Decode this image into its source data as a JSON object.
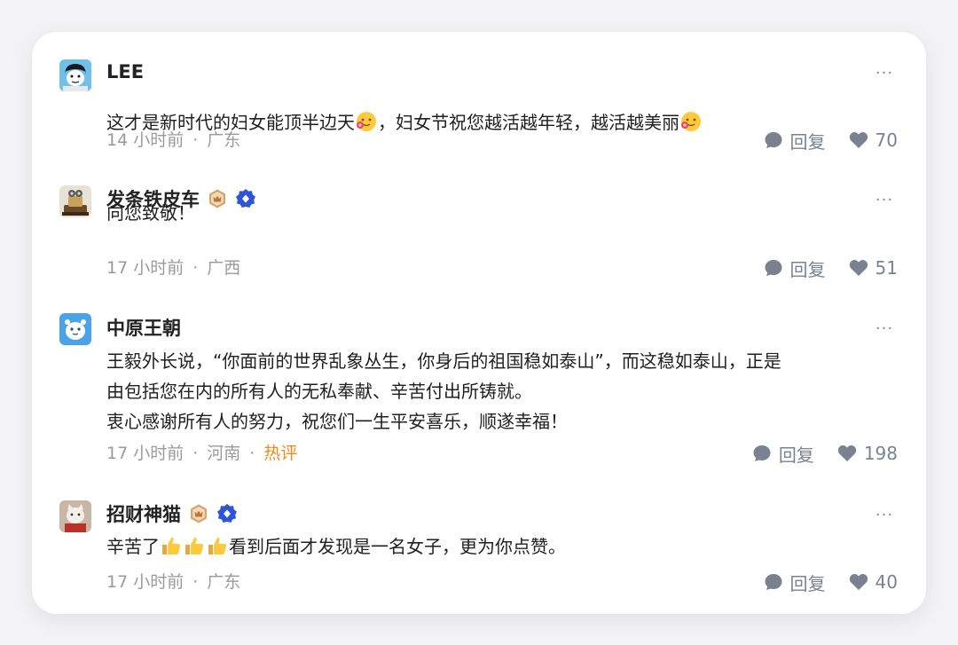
{
  "comments": [
    {
      "user": "LEE",
      "avatar_icon": "cartoon-face-avatar",
      "badges": [],
      "lines": [
        {
          "pre": "这才是新时代的妇女能顶半边天",
          "emoji": "flower-smile-emoji",
          "mid": "，妇女节祝您越活越年轻，越活越美丽",
          "emoji2": "flower-smile-emoji"
        }
      ],
      "time": "14 小时前",
      "location": "广东",
      "hot": "",
      "reply_label": "回复",
      "likes": "70"
    },
    {
      "user": "发条铁皮车",
      "avatar_icon": "robot-avatar",
      "badges": [
        "crown-badge-icon",
        "verified-badge-icon"
      ],
      "lines": [
        {
          "text": "向您致敬！"
        }
      ],
      "time": "17 小时前",
      "location": "广西",
      "hot": "",
      "reply_label": "回复",
      "likes": "51"
    },
    {
      "user": "中原王朝",
      "avatar_icon": "blue-mascot-avatar",
      "badges": [],
      "lines": [
        {
          "text": "王毅外长说，“你面前的世界乱象丛生，你身后的祖国稳如泰山”，而这稳如泰山，正是"
        },
        {
          "text": "由包括您在内的所有人的无私奉献、辛苦付出所铸就。"
        },
        {
          "text": "衷心感谢所有人的努力，祝您们一生平安喜乐，顺遂幸福！"
        }
      ],
      "time": "17 小时前",
      "location": "河南",
      "hot": "热评",
      "reply_label": "回复",
      "likes": "198"
    },
    {
      "user": "招财神猫",
      "avatar_icon": "cat-avatar",
      "badges": [
        "crown-badge-icon",
        "verified-badge-icon"
      ],
      "lines": [
        {
          "pre": "辛苦了",
          "thumbs": 3,
          "mid": "看到后面才发现是一名女子，更为你点赞。"
        }
      ],
      "time": "17 小时前",
      "location": "广东",
      "hot": "",
      "reply_label": "回复",
      "likes": "40"
    }
  ],
  "separator": "·",
  "more_label": "···",
  "colors": {
    "hot": "#f08a1d",
    "meta": "#9a9a9a",
    "action": "#7a8190",
    "crown_badge": "#d7a36a",
    "verified_badge": "#2f55d4"
  }
}
